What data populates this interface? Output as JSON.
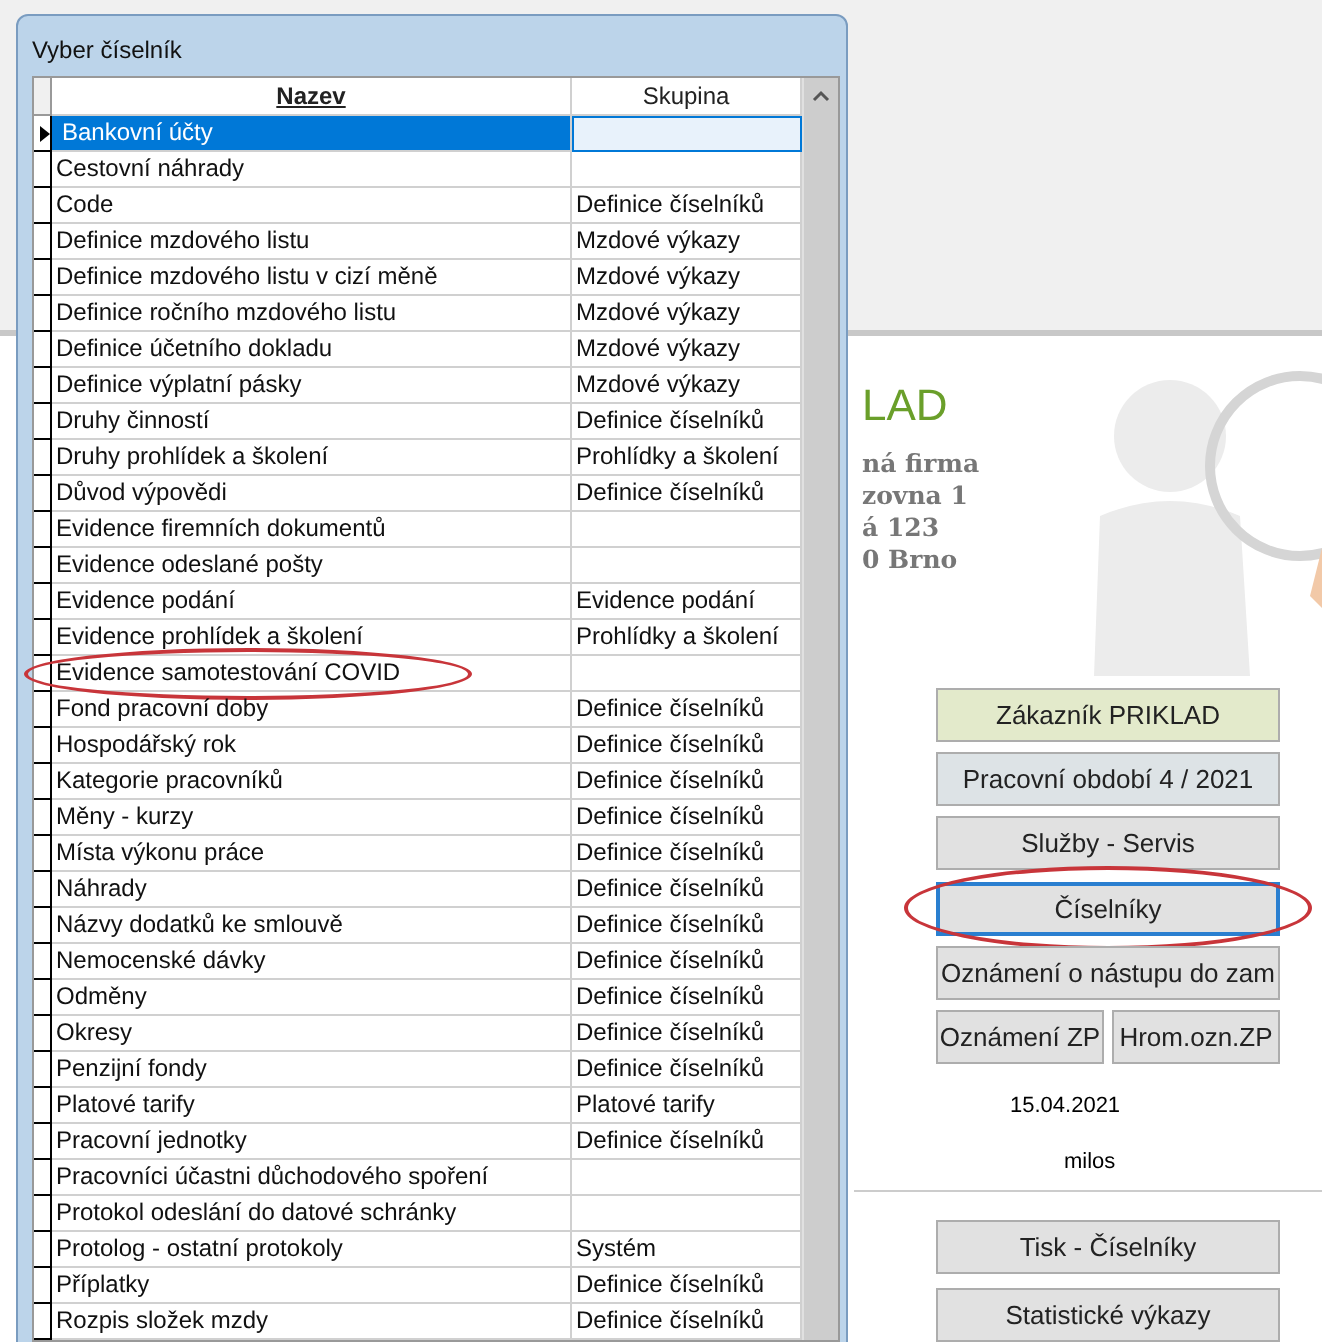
{
  "background_app": {
    "company_title": "LAD",
    "company_lines": [
      "ná firma",
      "zovna 1",
      "á 123",
      "0 Brno"
    ],
    "buttons": [
      {
        "label": "Zákazník  PRIKLAD",
        "kind": "customer",
        "highlighted": false
      },
      {
        "label": "Pracovní období  4 / 2021",
        "kind": "period",
        "highlighted": false
      },
      {
        "label": "Služby - Servis",
        "kind": "plain",
        "highlighted": false
      },
      {
        "label": "Číselníky",
        "kind": "focused",
        "highlighted": true
      },
      {
        "label": "Oznámení o nástupu do zam",
        "kind": "plain",
        "highlighted": false
      }
    ],
    "pair_buttons": [
      "Oznámení ZP",
      "Hrom.ozn.ZP"
    ],
    "date": "15.04.2021",
    "user": "milos",
    "bottom_buttons": [
      "Tisk - Číselníky",
      "Statistické výkazy"
    ]
  },
  "dialog": {
    "title": "Vyber číselník",
    "columns": [
      {
        "label": "Nazev",
        "sorted": true
      },
      {
        "label": "Skupina",
        "sorted": false
      }
    ],
    "rows": [
      {
        "name": "Bankovní účty",
        "group": "",
        "selected": true,
        "highlighted": false
      },
      {
        "name": "Cestovní náhrady",
        "group": "",
        "selected": false,
        "highlighted": false
      },
      {
        "name": "Code",
        "group": "Definice číselníků",
        "selected": false,
        "highlighted": false
      },
      {
        "name": "Definice mzdového listu",
        "group": "Mzdové výkazy",
        "selected": false,
        "highlighted": false
      },
      {
        "name": "Definice mzdového listu v cizí měně",
        "group": "Mzdové výkazy",
        "selected": false,
        "highlighted": false
      },
      {
        "name": "Definice ročního mzdového listu",
        "group": "Mzdové výkazy",
        "selected": false,
        "highlighted": false
      },
      {
        "name": "Definice účetního dokladu",
        "group": "Mzdové výkazy",
        "selected": false,
        "highlighted": false
      },
      {
        "name": "Definice výplatní pásky",
        "group": "Mzdové výkazy",
        "selected": false,
        "highlighted": false
      },
      {
        "name": "Druhy činností",
        "group": "Definice číselníků",
        "selected": false,
        "highlighted": false
      },
      {
        "name": "Druhy prohlídek a školení",
        "group": "Prohlídky a školení",
        "selected": false,
        "highlighted": false
      },
      {
        "name": "Důvod výpovědi",
        "group": "Definice číselníků",
        "selected": false,
        "highlighted": false
      },
      {
        "name": "Evidence firemních dokumentů",
        "group": "",
        "selected": false,
        "highlighted": false
      },
      {
        "name": "Evidence odeslané pošty",
        "group": "",
        "selected": false,
        "highlighted": false
      },
      {
        "name": "Evidence podání",
        "group": "Evidence podání",
        "selected": false,
        "highlighted": false
      },
      {
        "name": "Evidence prohlídek a školení",
        "group": "Prohlídky a školení",
        "selected": false,
        "highlighted": false
      },
      {
        "name": "Evidence samotestování COVID",
        "group": "",
        "selected": false,
        "highlighted": true
      },
      {
        "name": "Fond pracovní doby",
        "group": "Definice číselníků",
        "selected": false,
        "highlighted": false
      },
      {
        "name": "Hospodářský rok",
        "group": "Definice číselníků",
        "selected": false,
        "highlighted": false
      },
      {
        "name": "Kategorie pracovníků",
        "group": "Definice číselníků",
        "selected": false,
        "highlighted": false
      },
      {
        "name": "Měny - kurzy",
        "group": "Definice číselníků",
        "selected": false,
        "highlighted": false
      },
      {
        "name": "Místa výkonu práce",
        "group": "Definice číselníků",
        "selected": false,
        "highlighted": false
      },
      {
        "name": "Náhrady",
        "group": "Definice číselníků",
        "selected": false,
        "highlighted": false
      },
      {
        "name": "Názvy dodatků ke smlouvě",
        "group": "Definice číselníků",
        "selected": false,
        "highlighted": false
      },
      {
        "name": "Nemocenské dávky",
        "group": "Definice číselníků",
        "selected": false,
        "highlighted": false
      },
      {
        "name": "Odměny",
        "group": "Definice číselníků",
        "selected": false,
        "highlighted": false
      },
      {
        "name": "Okresy",
        "group": "Definice číselníků",
        "selected": false,
        "highlighted": false
      },
      {
        "name": "Penzijní fondy",
        "group": "Definice číselníků",
        "selected": false,
        "highlighted": false
      },
      {
        "name": "Platové tarify",
        "group": "Platové tarify",
        "selected": false,
        "highlighted": false
      },
      {
        "name": "Pracovní jednotky",
        "group": "Definice číselníků",
        "selected": false,
        "highlighted": false
      },
      {
        "name": "Pracovníci  účastni důchodového spoření",
        "group": "",
        "selected": false,
        "highlighted": false
      },
      {
        "name": "Protokol odeslání do datové schránky",
        "group": "",
        "selected": false,
        "highlighted": false
      },
      {
        "name": "Protolog - ostatní protokoly",
        "group": "Systém",
        "selected": false,
        "highlighted": false
      },
      {
        "name": "Příplatky",
        "group": "Definice číselníků",
        "selected": false,
        "highlighted": false
      },
      {
        "name": "Rozpis složek mzdy",
        "group": "Definice číselníků",
        "selected": false,
        "highlighted": false
      }
    ]
  }
}
